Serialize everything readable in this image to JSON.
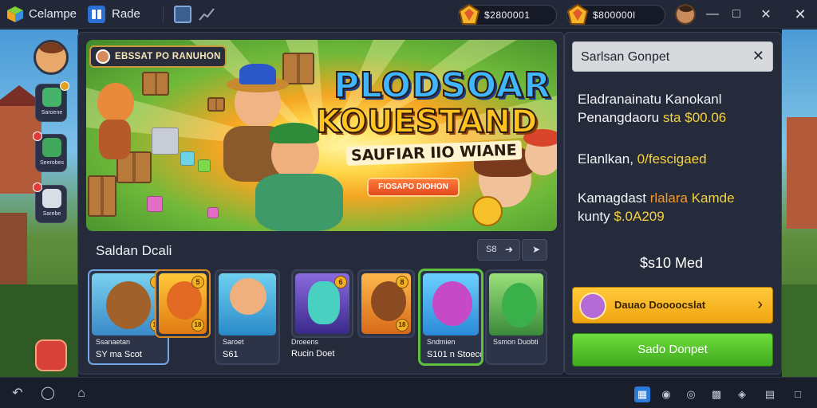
{
  "topbar": {
    "app_name": "Celampe",
    "tab_label": "Rade",
    "currency1": "$2800001",
    "currency2": "$800000l"
  },
  "sidebar": {
    "items": [
      {
        "label": "Saroene"
      },
      {
        "label": "Seerobes"
      },
      {
        "label": "Sarebe"
      }
    ]
  },
  "banner": {
    "tag": "EBSSAT PO RANUHON",
    "title_line1": "PLODSOAR",
    "title_line2": "KOUESTAND",
    "subtitle": "SAUFIAR IIO WIANE",
    "cta": "FIOSAPO DIOHON"
  },
  "featured": {
    "title": "Saldan Dcali",
    "control1": "S8",
    "cards": [
      {
        "name": "Ssanaetan",
        "price": "SY ma Scot"
      },
      {
        "name": "",
        "price": ""
      },
      {
        "name": "Saroet",
        "price": "S61"
      },
      {
        "name": "",
        "price": ""
      },
      {
        "name": "Droeens",
        "price": "Rucin Doet"
      },
      {
        "name": "Sndmien",
        "price": "S101 n Stoeco"
      },
      {
        "name": "Ssmon Duobti",
        "price": ""
      }
    ]
  },
  "rpanel": {
    "header": "Sarlsan Gonpet",
    "line1": "Eladranainatu Kanokanl",
    "line2a": "Penangdaoru",
    "line2b": "sta",
    "line2c": "$00.06",
    "line3a": "Elanlkan,",
    "line3b": "0/fescigaed",
    "line4a": "Kamagdast",
    "line4b": "rlalara",
    "line4c": "Kamde",
    "line5a": "kunty",
    "line5b": "$.0A209",
    "total": "$s10 Med",
    "btn_yellow": "Dauao Doooocslat",
    "btn_green": "Sado Donpet"
  },
  "colors": {
    "accent_yellow": "#f0a512",
    "accent_green": "#3faa1e",
    "panel_bg": "#262b3b"
  }
}
